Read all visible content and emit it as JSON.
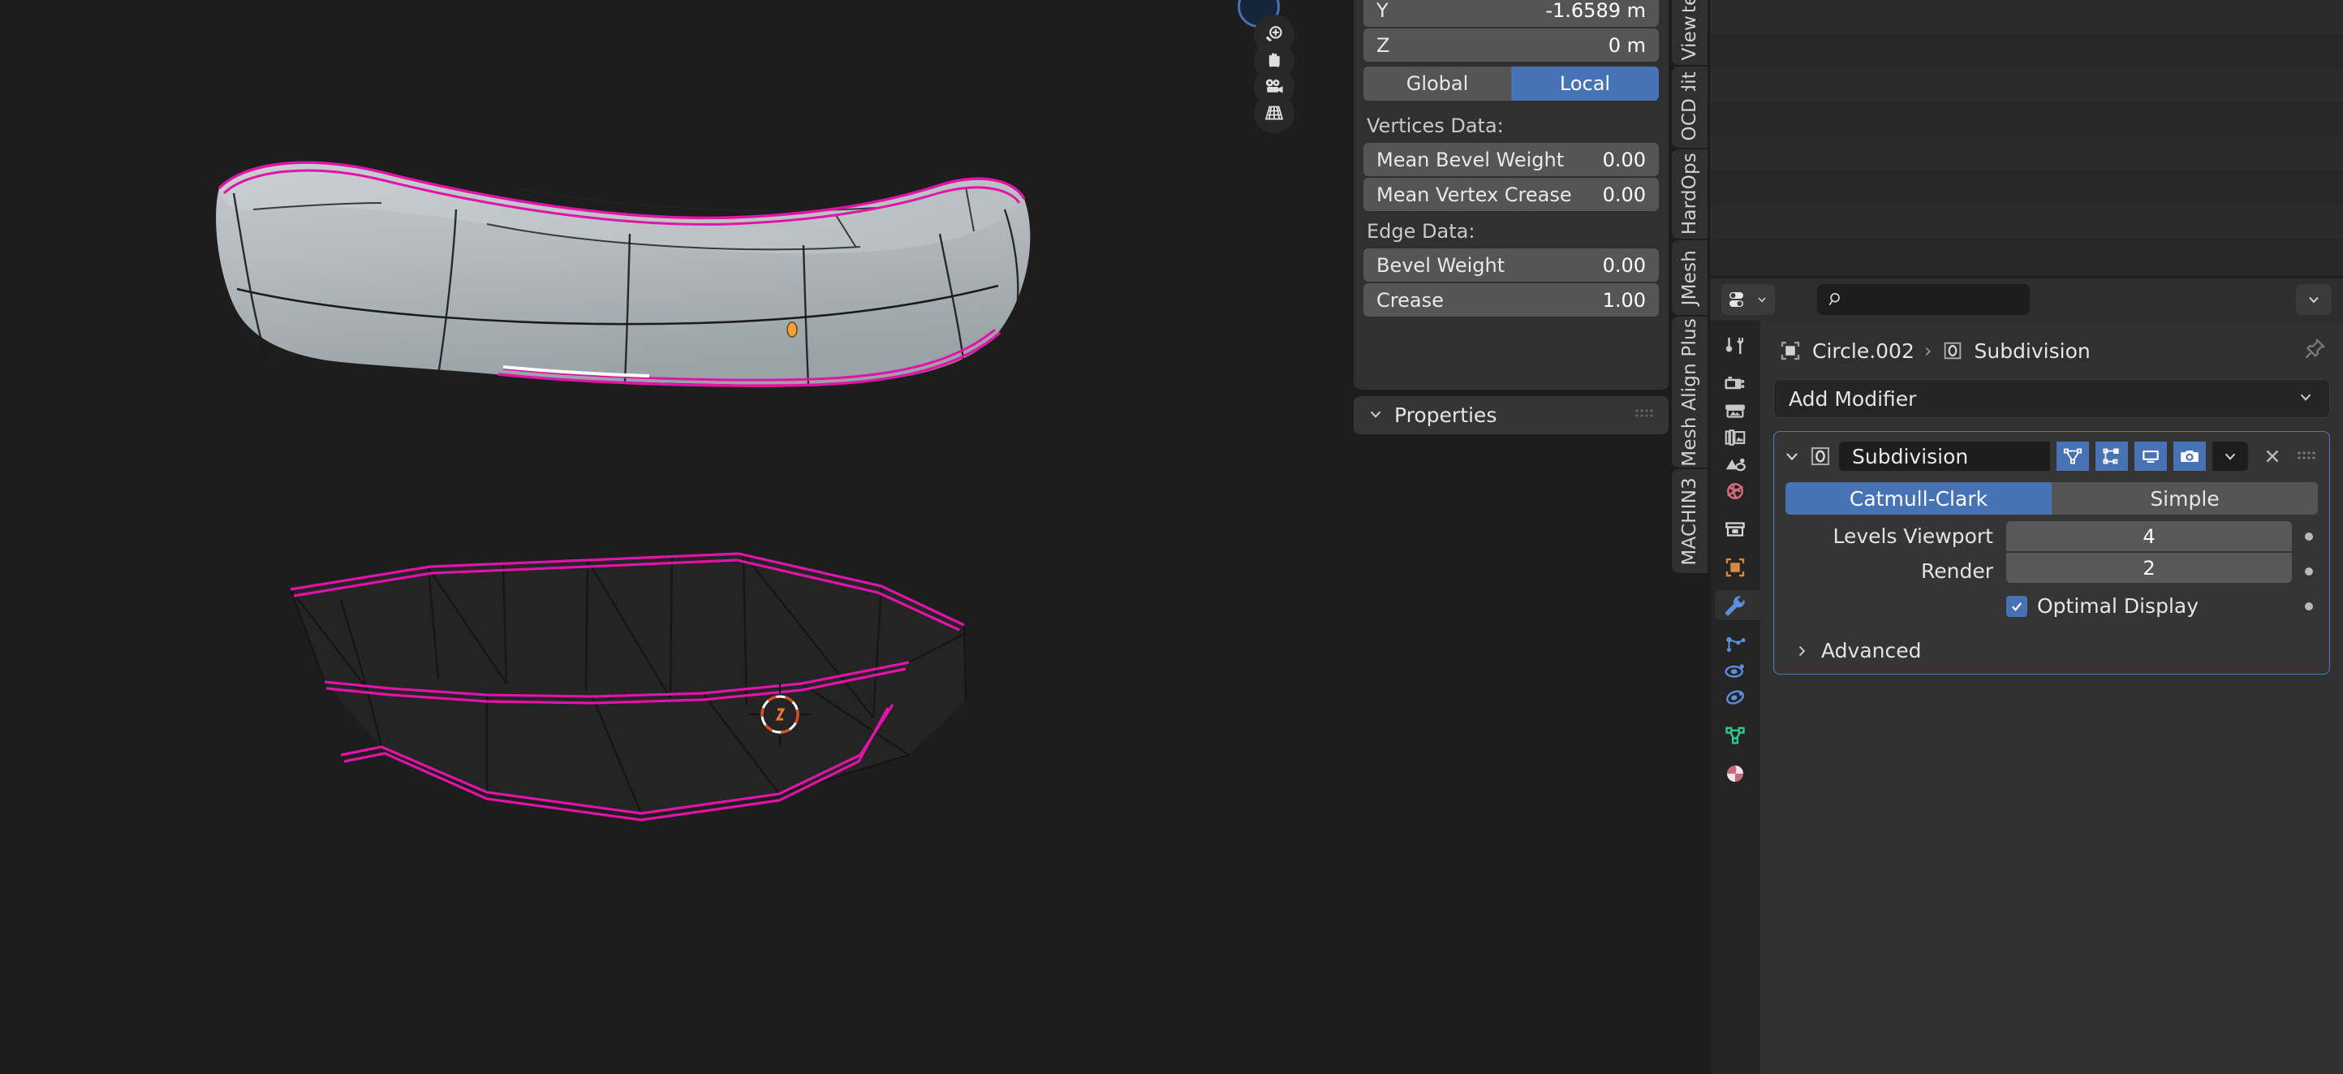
{
  "app": "Blender",
  "viewport": {
    "gizmo_buttons": [
      {
        "name": "zoom-view",
        "icon": "magnifier-plus-icon"
      },
      {
        "name": "move-view",
        "icon": "hand-icon"
      },
      {
        "name": "camera-view",
        "icon": "camera-icon"
      },
      {
        "name": "toggle-perspective-ortho",
        "icon": "grid-perspective-icon"
      }
    ],
    "nav_gizmo": "axis-navigation-ball",
    "objects": [
      {
        "name": "subdivided-hull-mesh",
        "shading": "solid",
        "selection_color": "#e213a8"
      },
      {
        "name": "base-cage-mesh",
        "shading": "wireframe",
        "selection_color": "#e213a8"
      }
    ],
    "cursor": "3d-cursor",
    "origin_marker": "object-origin-dot"
  },
  "sidebar": {
    "transform": {
      "rows": [
        {
          "label": "Y",
          "value": "-1.6589 m"
        },
        {
          "label": "Z",
          "value": "0 m"
        }
      ],
      "orientation_options": [
        "Global",
        "Local"
      ],
      "orientation_selected": "Local"
    },
    "vertices_data": {
      "header": "Vertices Data:",
      "rows": [
        {
          "label": "Mean Bevel Weight",
          "value": "0.00"
        },
        {
          "label": "Mean Vertex Crease",
          "value": "0.00"
        }
      ]
    },
    "edge_data": {
      "header": "Edge Data:",
      "rows": [
        {
          "label": "Bevel Weight",
          "value": "0.00"
        },
        {
          "label": "Crease",
          "value": "1.00"
        }
      ]
    },
    "properties_panel": {
      "title": "Properties",
      "collapsed": false
    }
  },
  "tabstrip": {
    "items": [
      {
        "label": "Item"
      },
      {
        "label": "View"
      },
      {
        "label": "Edit"
      },
      {
        "label": "OCD"
      },
      {
        "label": "HardOps"
      },
      {
        "label": "JMesh"
      },
      {
        "label": "Mesh Align Plus"
      },
      {
        "label": "MACHIN3"
      }
    ]
  },
  "outliner": {
    "rows": 8
  },
  "properties_editor": {
    "header": {
      "editor_type": "editor-type-selector",
      "search_placeholder": "",
      "options_label": "options-dropdown"
    },
    "tabs": [
      {
        "name": "tool",
        "icon": "tool-icon",
        "color": "#c8c8c8",
        "active": false
      },
      {
        "name": "render",
        "icon": "render-camera-icon",
        "color": "#c8c8c8",
        "active": false
      },
      {
        "name": "output",
        "icon": "printer-output-icon",
        "color": "#c8c8c8",
        "active": false
      },
      {
        "name": "view-layer",
        "icon": "images-stack-icon",
        "color": "#c8c8c8",
        "active": false
      },
      {
        "name": "scene",
        "icon": "scene-cone-icon",
        "color": "#c8c8c8",
        "active": false
      },
      {
        "name": "world",
        "icon": "world-globe-icon",
        "color": "#d06a7f",
        "active": false
      },
      {
        "name": "collection",
        "icon": "collection-box-icon",
        "color": "#d8d8d8",
        "active": false
      },
      {
        "name": "object",
        "icon": "object-square-icon",
        "color": "#d9883f",
        "active": false
      },
      {
        "name": "modifiers",
        "icon": "wrench-icon",
        "color": "#5b8ede",
        "active": true
      },
      {
        "name": "particles",
        "icon": "particles-icon",
        "color": "#5b8ede",
        "active": false
      },
      {
        "name": "physics",
        "icon": "physics-orbit-icon",
        "color": "#5b8ede",
        "active": false
      },
      {
        "name": "constraints",
        "icon": "constraints-icon",
        "color": "#5b8ede",
        "active": false
      },
      {
        "name": "object-data",
        "icon": "mesh-data-triangle-icon",
        "color": "#2ecb8f",
        "active": false
      },
      {
        "name": "material",
        "icon": "material-sphere-icon",
        "color": "#c9697b",
        "active": false
      }
    ],
    "breadcrumb": {
      "object_name": "Circle.002",
      "separator": "›",
      "modifier_name": "Subdivision",
      "pin_icon": "pin-icon"
    },
    "add_modifier_label": "Add Modifier",
    "modifier": {
      "name": "Subdivision",
      "expanded": true,
      "toggles": [
        {
          "name": "on-cage",
          "icon": "on-cage-icon",
          "enabled": true
        },
        {
          "name": "edit-mode",
          "icon": "edit-mode-icon",
          "enabled": true
        },
        {
          "name": "realtime",
          "icon": "monitor-icon",
          "enabled": true
        },
        {
          "name": "render",
          "icon": "camera-icon",
          "enabled": true
        }
      ],
      "extras_icon": "chevron-down-icon",
      "delete_icon": "x-close-icon",
      "drag_icon": "drag-grip-icon",
      "subdivision_type": {
        "options": [
          "Catmull-Clark",
          "Simple"
        ],
        "selected": "Catmull-Clark"
      },
      "fields": [
        {
          "label": "Levels Viewport",
          "value": "4"
        },
        {
          "label": "Render",
          "value": "2"
        }
      ],
      "checkbox": {
        "label": "Optimal Display",
        "checked": true
      },
      "advanced_label": "Advanced",
      "advanced_expanded": false
    }
  },
  "colors": {
    "accent_blue": "#4772b3",
    "panel_bg": "#303030",
    "editor_bg": "#282828",
    "viewport_bg": "#1d1d1d",
    "selection_magenta": "#e213a8",
    "field_bg": "#555555"
  }
}
